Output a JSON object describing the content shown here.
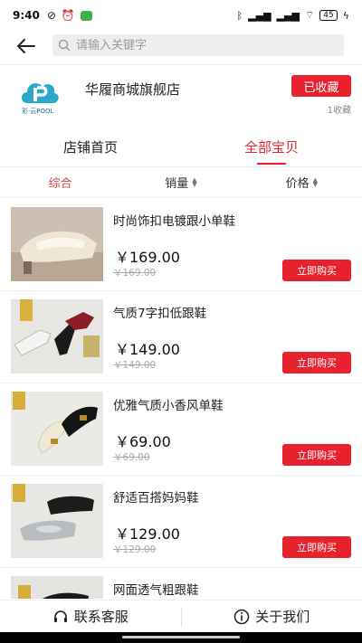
{
  "status_bar": {
    "time": "9:40",
    "battery": "45"
  },
  "search": {
    "placeholder": "请输入关键字"
  },
  "store": {
    "logo_text": "彩·云POOL",
    "name": "华履商城旗舰店",
    "fav_label": "已收藏",
    "fav_count": "1收藏"
  },
  "tabs": [
    {
      "label": "店铺首页"
    },
    {
      "label": "全部宝贝"
    }
  ],
  "sort": [
    {
      "label": "综合"
    },
    {
      "label": "销量"
    },
    {
      "label": "价格"
    }
  ],
  "products": [
    {
      "title": "时尚饰扣电镀跟小单鞋",
      "price": "￥169.00",
      "old_price": "￥169.00",
      "buy": "立即购买"
    },
    {
      "title": "气质7字扣低跟鞋",
      "price": "￥149.00",
      "old_price": "￥149.00",
      "buy": "立即购买"
    },
    {
      "title": "优雅气质小香风单鞋",
      "price": "￥69.00",
      "old_price": "￥69.00",
      "buy": "立即购买"
    },
    {
      "title": "舒适百搭妈妈鞋",
      "price": "￥129.00",
      "old_price": "￥129.00",
      "buy": "立即购买"
    },
    {
      "title": "网面透气粗跟鞋",
      "price": "",
      "old_price": "",
      "buy": ""
    }
  ],
  "bottom": {
    "service": "联系客服",
    "about": "关于我们"
  },
  "colors": {
    "accent": "#e8222d",
    "logo": "#2aa7c9"
  }
}
